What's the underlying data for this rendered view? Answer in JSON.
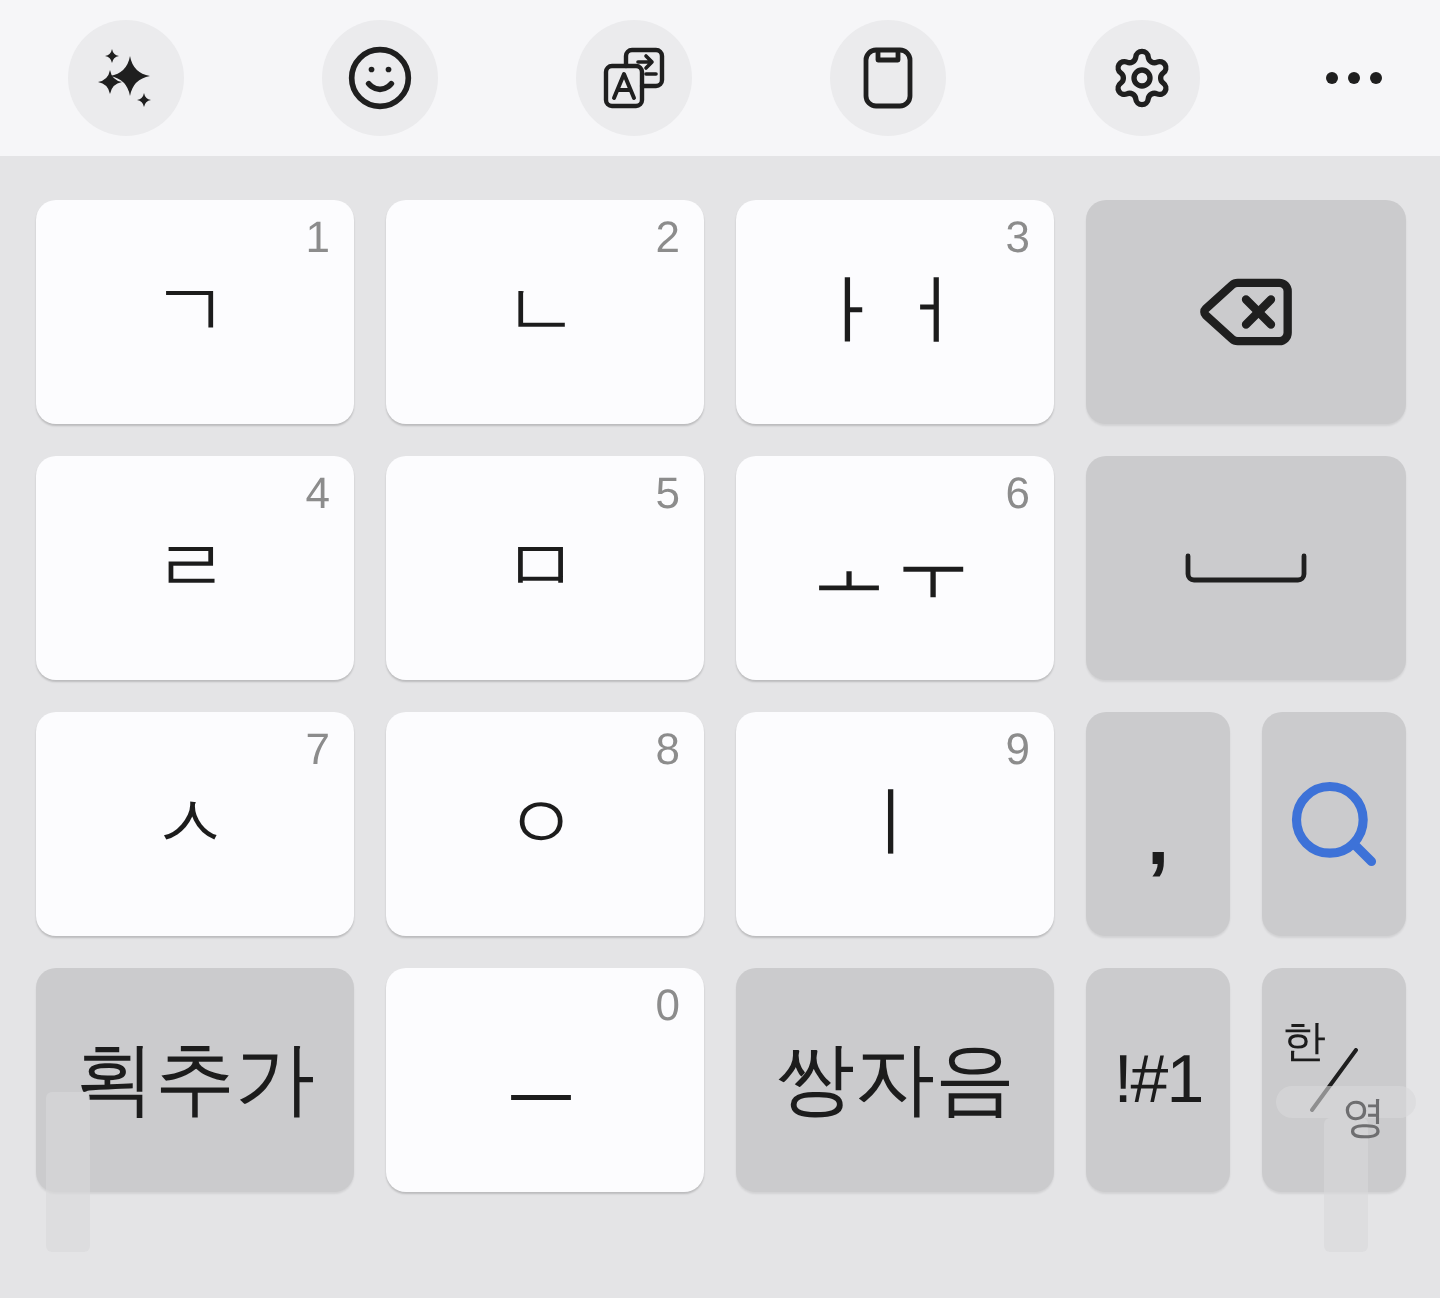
{
  "keyboard": {
    "rows": [
      {
        "keys": [
          {
            "kind": "letter",
            "label": "ㄱ",
            "number": "1"
          },
          {
            "kind": "letter",
            "label": "ㄴ",
            "number": "2"
          },
          {
            "kind": "letter",
            "label": "ㅏㅓ",
            "number": "3"
          },
          {
            "kind": "backspace"
          }
        ]
      },
      {
        "keys": [
          {
            "kind": "letter",
            "label": "ㄹ",
            "number": "4"
          },
          {
            "kind": "letter",
            "label": "ㅁ",
            "number": "5"
          },
          {
            "kind": "letter",
            "label": "ㅗㅜ",
            "number": "6"
          },
          {
            "kind": "space"
          }
        ]
      },
      {
        "keys": [
          {
            "kind": "letter",
            "label": "ㅅ",
            "number": "7"
          },
          {
            "kind": "letter",
            "label": "ㅇ",
            "number": "8"
          },
          {
            "kind": "letter",
            "label": "ㅣ",
            "number": "9"
          },
          {
            "kind": "comma",
            "label": ","
          },
          {
            "kind": "search"
          }
        ]
      },
      {
        "keys": [
          {
            "kind": "function",
            "label": "획추가"
          },
          {
            "kind": "letter",
            "label": "ㅡ",
            "number": "0"
          },
          {
            "kind": "function",
            "label": "쌍자음"
          },
          {
            "kind": "symbols",
            "label": "!#1"
          },
          {
            "kind": "language",
            "options": [
              {
                "label": "한",
                "selected": true
              },
              {
                "label": "영",
                "selected": false
              }
            ]
          }
        ]
      }
    ]
  }
}
